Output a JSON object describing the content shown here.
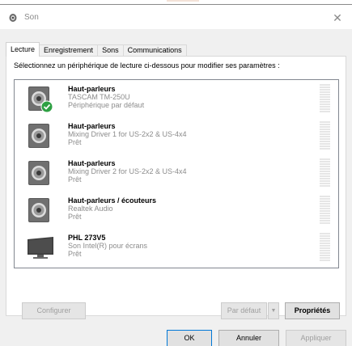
{
  "window": {
    "title": "Son",
    "close_glyph": "✕",
    "title_icon": "speaker-icon"
  },
  "tabs": [
    {
      "label": "Lecture",
      "active": true
    },
    {
      "label": "Enregistrement",
      "active": false
    },
    {
      "label": "Sons",
      "active": false
    },
    {
      "label": "Communications",
      "active": false
    }
  ],
  "instruction": "Sélectionnez un périphérique de lecture ci-dessous pour modifier ses paramètres :",
  "devices": [
    {
      "name": "Haut-parleurs",
      "model": "TASCAM TM-250U",
      "status": "Périphérique par défaut",
      "icon": "speaker-icon",
      "default": true
    },
    {
      "name": "Haut-parleurs",
      "model": "Mixing Driver 1 for US-2x2 & US-4x4",
      "status": "Prêt",
      "icon": "speaker-icon",
      "default": false
    },
    {
      "name": "Haut-parleurs",
      "model": "Mixing Driver 2 for US-2x2 & US-4x4",
      "status": "Prêt",
      "icon": "speaker-icon",
      "default": false
    },
    {
      "name": "Haut-parleurs / écouteurs",
      "model": "Realtek Audio",
      "status": "Prêt",
      "icon": "speaker-icon",
      "default": false
    },
    {
      "name": "PHL 273V5",
      "model": "Son Intel(R) pour écrans",
      "status": "Prêt",
      "icon": "monitor-icon",
      "default": false
    }
  ],
  "buttons": {
    "configure": "Configurer",
    "set_default": "Par défaut",
    "set_default_arrow": "▼",
    "properties": "Propriétés",
    "ok": "OK",
    "cancel": "Annuler",
    "apply": "Appliquer"
  },
  "colors": {
    "default_check": "#2ea043",
    "primary_border": "#0078d7"
  }
}
